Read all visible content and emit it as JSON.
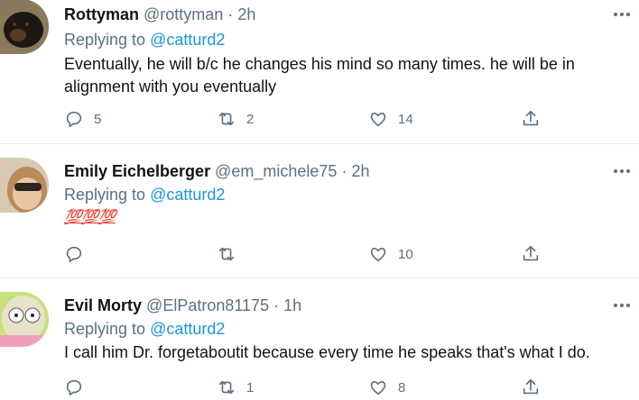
{
  "tweets": [
    {
      "name": "Rottyman",
      "handle": "@rottyman",
      "time": "2h",
      "replying_prefix": "Replying to",
      "replying_to": "@catturd2",
      "text": "Eventually, he will b/c he changes his mind so many times.  he will be in alignment with you eventually",
      "replies": "5",
      "retweets": "2",
      "likes": "14"
    },
    {
      "name": "Emily Eichelberger",
      "handle": "@em_michele75",
      "time": "2h",
      "replying_prefix": "Replying to",
      "replying_to": "@catturd2",
      "text": "💯💯💯",
      "replies": "",
      "retweets": "",
      "likes": "10"
    },
    {
      "name": "Evil Morty",
      "handle": "@ElPatron81175",
      "time": "1h",
      "replying_prefix": "Replying to",
      "replying_to": "@catturd2",
      "text": "I call him Dr. forgetaboutit because every time he speaks that's what I do.",
      "replies": "",
      "retweets": "1",
      "likes": "8"
    }
  ],
  "separator": "·",
  "colors": {
    "secondary": "#5b7083",
    "link": "#1b95e0",
    "text": "#0f1419",
    "border": "#e6ecf0"
  },
  "icons": [
    "reply-icon",
    "retweet-icon",
    "like-icon",
    "share-icon",
    "more-icon"
  ]
}
